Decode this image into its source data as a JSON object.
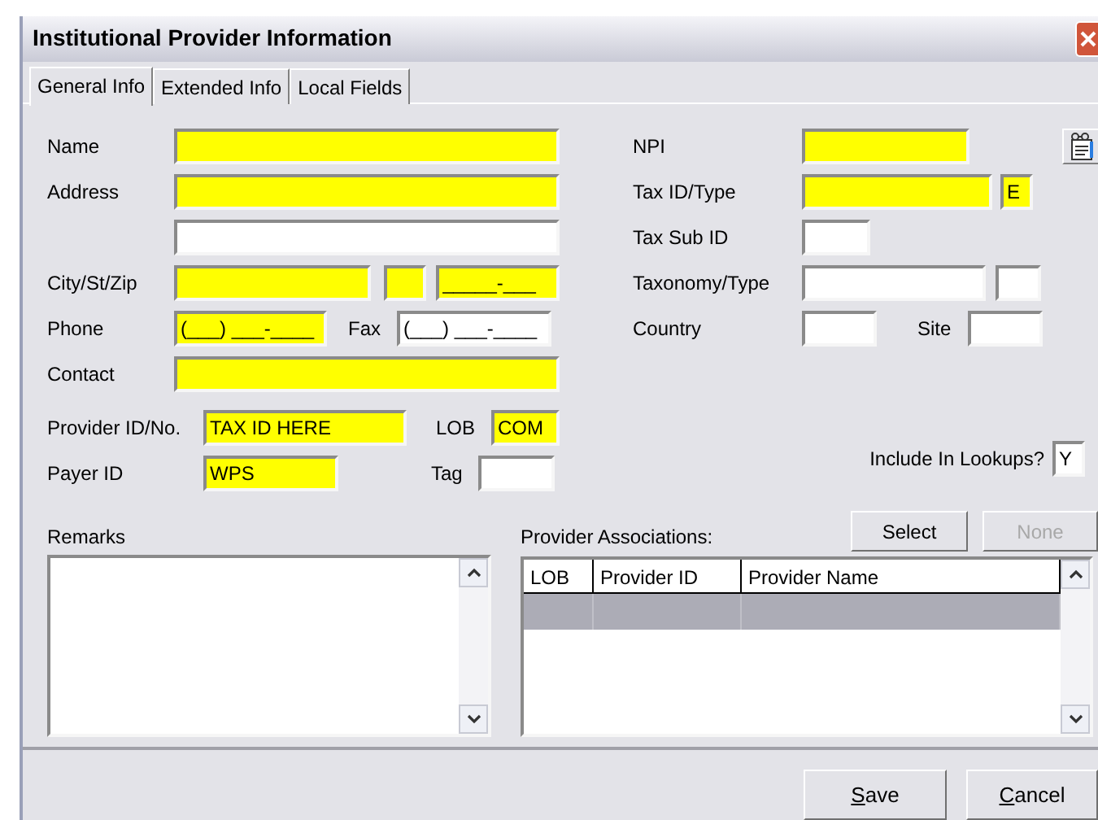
{
  "window": {
    "title": "Institutional Provider Information"
  },
  "tabs": [
    {
      "label": "General Info",
      "selected": true
    },
    {
      "label": "Extended Info",
      "selected": false
    },
    {
      "label": "Local Fields",
      "selected": false
    }
  ],
  "form": {
    "name": {
      "label": "Name",
      "required": true
    },
    "address": {
      "label": "Address",
      "required": true
    },
    "address_line_2": {
      "required": false
    },
    "city_st_zip": {
      "label": "City/St/Zip",
      "city": {
        "required": true
      },
      "state": {
        "required": true
      },
      "zip": {
        "value": "_____-___",
        "required": true
      }
    },
    "phone": {
      "label": "Phone",
      "value": "(___) ___-____",
      "required": true
    },
    "fax": {
      "label": "Fax",
      "value": "(___) ___-____",
      "required": false
    },
    "contact": {
      "label": "Contact",
      "required": true
    },
    "provider_id": {
      "label": "Provider ID/No.",
      "value": "TAX ID HERE",
      "required": true
    },
    "lob": {
      "label": "LOB",
      "value": "COM",
      "required": true
    },
    "payer_id": {
      "label": "Payer ID",
      "value": "WPS",
      "required": true
    },
    "tag": {
      "label": "Tag",
      "required": false
    },
    "npi": {
      "label": "NPI",
      "required": true
    },
    "tax_id": {
      "label": "Tax ID/Type",
      "required": true
    },
    "tax_type": {
      "value": "E",
      "required": true
    },
    "tax_sub_id": {
      "label": "Tax Sub ID",
      "required": false
    },
    "taxonomy": {
      "label": "Taxonomy/Type",
      "required": false
    },
    "taxonomy_type": {
      "required": false
    },
    "country": {
      "label": "Country",
      "required": false
    },
    "site": {
      "label": "Site",
      "required": false
    },
    "include_in_lookups": {
      "label": "Include In Lookups?",
      "value": "Y",
      "required": false
    }
  },
  "remarks": {
    "label": "Remarks"
  },
  "associations": {
    "label": "Provider Associations:",
    "buttons": [
      {
        "label": "Select",
        "disabled": false
      },
      {
        "label": "None",
        "disabled": true
      }
    ],
    "columns": [
      "LOB",
      "Provider ID",
      "Provider Name"
    ],
    "rows": [
      {
        "selected": true
      }
    ]
  },
  "buttons": [
    {
      "label": "Save",
      "underline_first": true
    },
    {
      "label": "Cancel",
      "underline_first": true
    }
  ]
}
